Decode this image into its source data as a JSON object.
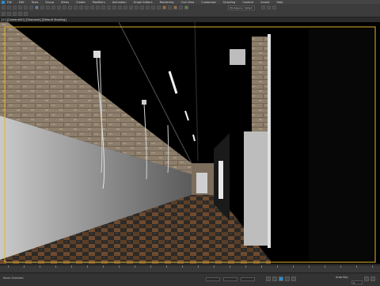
{
  "menu": {
    "items": [
      "File",
      "Edit",
      "Tools",
      "Group",
      "Views",
      "Create",
      "Modifiers",
      "Animation",
      "Graph Editors",
      "Rendering",
      "Civil View",
      "Customize",
      "Scripting",
      "Content",
      "Arnold",
      "Help"
    ]
  },
  "toolbar": {
    "workspace_value": "Workspace: Default"
  },
  "viewport": {
    "label": "[+] [Camera001] [Standard] [Default Shading]"
  },
  "timeline": {
    "current_frame": "0 / 100"
  },
  "status": {
    "selection_text": "None Selected",
    "autokey_label": "Auto Key",
    "frame_value": "0"
  },
  "colors": {
    "accent": "#2a8dd4",
    "viewport_frame": "#e0b42e"
  }
}
